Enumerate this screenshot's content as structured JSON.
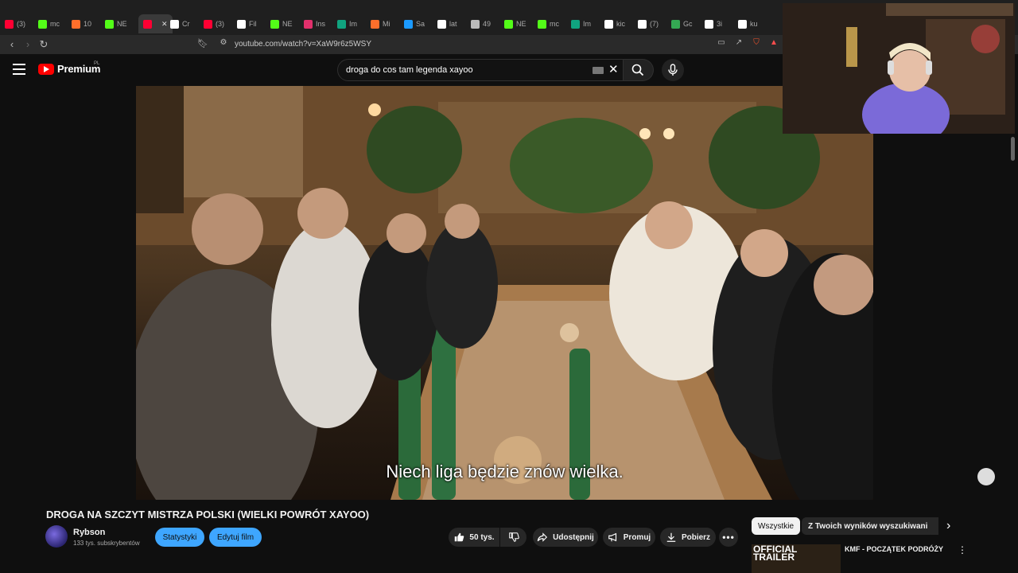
{
  "browser": {
    "tabs": [
      {
        "label": "(3)",
        "color": "#ff0033"
      },
      {
        "label": "mc",
        "color": "#53fc18"
      },
      {
        "label": "10",
        "color": "#ff6f2b"
      },
      {
        "label": "NE",
        "color": "#53fc18"
      },
      {
        "label": "",
        "color": "#ff0033",
        "active": true
      },
      {
        "label": "Cr",
        "color": "#ffffff"
      },
      {
        "label": "(3)",
        "color": "#ff0033"
      },
      {
        "label": "Fil",
        "color": "#ffffff"
      },
      {
        "label": "NE",
        "color": "#53fc18"
      },
      {
        "label": "Ins",
        "color": "#e1306c"
      },
      {
        "label": "Im",
        "color": "#10a37f"
      },
      {
        "label": "Mi",
        "color": "#ff6f2b"
      },
      {
        "label": "Sa",
        "color": "#1b9aff"
      },
      {
        "label": "lat",
        "color": "#ffffff"
      },
      {
        "label": "49",
        "color": "#bbbbbb"
      },
      {
        "label": "NE",
        "color": "#53fc18"
      },
      {
        "label": "mc",
        "color": "#53fc18"
      },
      {
        "label": "Im",
        "color": "#10a37f"
      },
      {
        "label": "kic",
        "color": "#ffffff"
      },
      {
        "label": "(7)",
        "color": "#ffffff"
      },
      {
        "label": "Gc",
        "color": "#34a853"
      },
      {
        "label": "3i",
        "color": "#ffffff"
      },
      {
        "label": "ku",
        "color": "#ffffff"
      }
    ],
    "url": "youtube.com/watch?v=XaW9r6z5WSY"
  },
  "header": {
    "logo_text": "Premium",
    "country": "PL",
    "search_query": "droga do cos tam legenda xayoo"
  },
  "video": {
    "subtitle": "Niech liga będzie znów wielka."
  },
  "info": {
    "title": "DROGA NA SZCZYT MISTRZA POLSKI (WIELKI POWRÓT XAYOO)",
    "channel": "Rybson",
    "subscribers": "133 tys. subskrybentów",
    "stats_label": "Statystyki",
    "edit_label": "Edytuj film",
    "likes": "50 tys.",
    "share_label": "Udostępnij",
    "promote_label": "Promuj",
    "download_label": "Pobierz"
  },
  "sidebar": {
    "chips": [
      "Wszystkie",
      "Z Twoich wyników wyszukiwania"
    ],
    "rec_title": "KMF - POCZĄTEK PODRÓŻY",
    "rec_thumb_label": "OFFICIAL TRAILER"
  },
  "colors": {
    "accent_blue": "#3ea6ff",
    "youtube_red": "#ff0000"
  }
}
